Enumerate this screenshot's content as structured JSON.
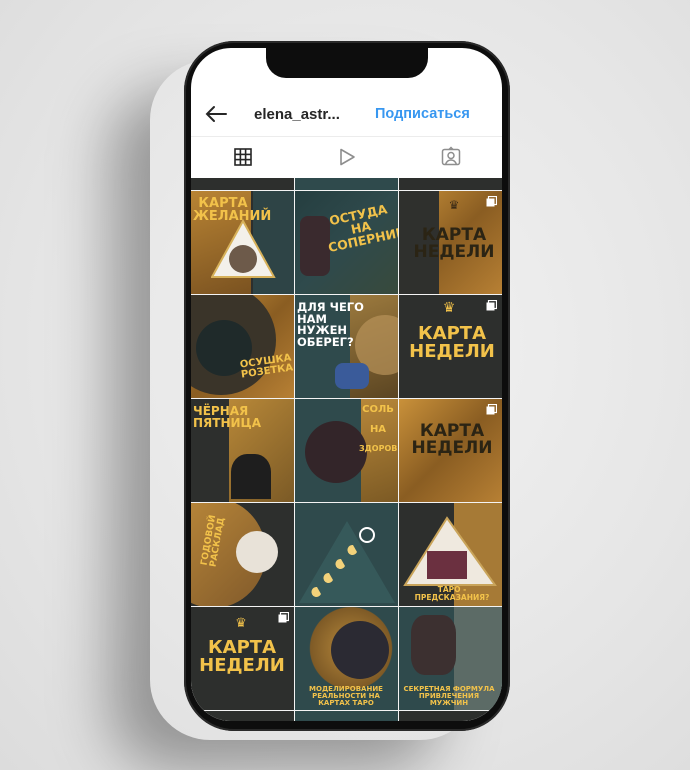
{
  "header": {
    "username": "elena_astr...",
    "follow_label": "Подписаться",
    "back_icon": "arrow-left-icon"
  },
  "tabs": [
    {
      "name": "grid",
      "icon": "grid-icon",
      "active": true
    },
    {
      "name": "reels",
      "icon": "play-icon",
      "active": false
    },
    {
      "name": "tagged",
      "icon": "person-tag-icon",
      "active": false
    }
  ],
  "posts": {
    "r1c1": {
      "lines": [
        "КАРТА",
        "ЖЕЛАНИЙ"
      ]
    },
    "r1c2": {
      "lines": [
        "ОСТУДА",
        "НА",
        "СОПЕРНИЦУ"
      ]
    },
    "r1c3": {
      "lines": [
        "КАРТА",
        "НЕДЕЛИ"
      ]
    },
    "r2c1": {
      "lines": [
        "ОСУШКА",
        "РОЗЕТКА"
      ]
    },
    "r2c2": {
      "lines": [
        "ДЛЯ ЧЕГО",
        "НАМ НУЖЕН",
        "ОБЕРЕГ?"
      ]
    },
    "r2c3": {
      "lines": [
        "КАРТА",
        "НЕДЕЛИ"
      ]
    },
    "r3c1": {
      "lines": [
        "ЧЁРНАЯ",
        "ПЯТНИЦА"
      ]
    },
    "r3c2": {
      "lines": [
        "СОЛЬ",
        "НА",
        "ЗДОРОВЬЕ"
      ]
    },
    "r3c3": {
      "lines": [
        "КАРТА",
        "НЕДЕЛИ"
      ]
    },
    "r4c1": {
      "lines": [
        "ГОДОВОЙ",
        "РАСКЛАД"
      ]
    },
    "r4c3": {
      "lines": [
        "ТАРО - ПРЕДСКАЗАНИЯ?"
      ]
    },
    "r5c1": {
      "lines": [
        "КАРТА",
        "НЕДЕЛИ"
      ]
    },
    "r5c2": {
      "lines": [
        "МОДЕЛИРОВАНИЕ",
        "РЕАЛЬНОСТИ НА КАРТАХ ТАРО"
      ]
    },
    "r5c3": {
      "lines": [
        "СЕКРЕТНАЯ ФОРМУЛА",
        "ПРИВЛЕЧЕНИЯ МУЖЧИН"
      ]
    }
  },
  "colors": {
    "follow": "#3897f0",
    "gold_text": "#f2c24a",
    "dark_bg": "#2d2f2d",
    "teal_bg": "#2f4a4c"
  }
}
